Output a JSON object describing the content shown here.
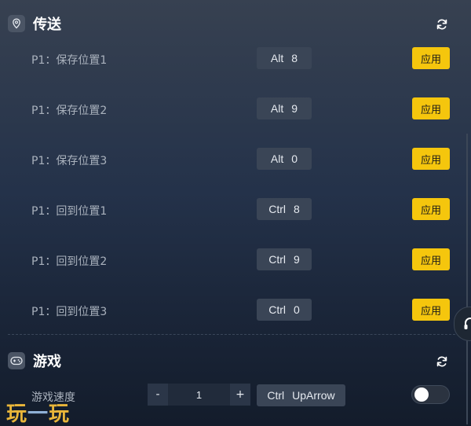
{
  "teleport": {
    "title": "传送",
    "icon": "location-pin-icon",
    "rows": [
      {
        "label": "P1：保存位置1",
        "key1": "Alt",
        "key2": "8",
        "button": "应用"
      },
      {
        "label": "P1：保存位置2",
        "key1": "Alt",
        "key2": "9",
        "button": "应用"
      },
      {
        "label": "P1：保存位置3",
        "key1": "Alt",
        "key2": "0",
        "button": "应用"
      },
      {
        "label": "P1：回到位置1",
        "key1": "Ctrl",
        "key2": "8",
        "button": "应用"
      },
      {
        "label": "P1：回到位置2",
        "key1": "Ctrl",
        "key2": "9",
        "button": "应用"
      },
      {
        "label": "P1：回到位置3",
        "key1": "Ctrl",
        "key2": "0",
        "button": "应用"
      }
    ]
  },
  "game": {
    "title": "游戏",
    "icon": "gamepad-icon",
    "speed_row": {
      "label": "游戏速度",
      "minus": "-",
      "value": "1",
      "plus": "+",
      "key1": "Ctrl",
      "key2": "UpArrow",
      "toggle_on": false
    }
  },
  "watermark": {
    "part1": "玩",
    "part2": "一",
    "part3": "玩"
  },
  "colors": {
    "accent": "#f5c60d",
    "panel_key_bg": "#3a4556"
  }
}
